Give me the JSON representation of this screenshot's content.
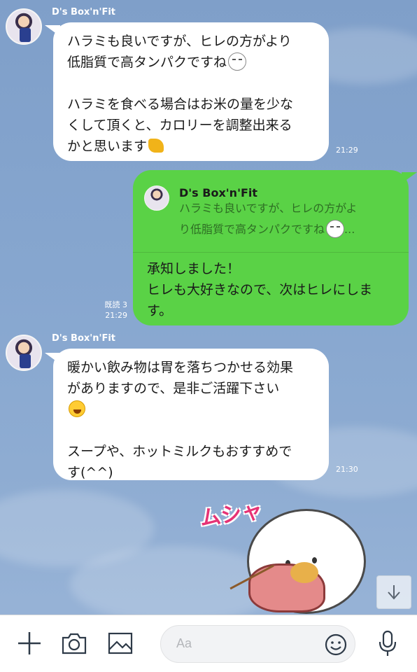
{
  "messages": [
    {
      "sender": "D's Box'n'Fit",
      "lines_a": [
        "ハラミも良いですが、ヒレの方がより",
        "低脂質で高タンパクですね"
      ],
      "lines_b": [
        "ハラミを食べる場合はお米の量を少な",
        "くして頂くと、カロリーを調整出来る",
        "かと思います"
      ],
      "time": "21:29"
    },
    {
      "reply_to": {
        "name": "D's Box'n'Fit",
        "lines": [
          "ハラミも良いですが、ヒレの方がよ",
          "り低脂質で高タンパクですね",
          "..."
        ]
      },
      "lines": [
        "承知しました！",
        "ヒレも大好きなので、次はヒレにしま",
        "す。"
      ],
      "read": "既読 3",
      "time": "21:29"
    },
    {
      "sender": "D's Box'n'Fit",
      "lines_a": [
        "暖かい飲み物は胃を落ちつかせる効果",
        "がありますので、是非ご活躍下さい"
      ],
      "lines_b": [
        "スープや、ホットミルクもおすすめで",
        "す(^^)"
      ],
      "time": "21:30"
    }
  ],
  "sticker": {
    "text": "ムシャ",
    "icon": "eating-character-sticker"
  },
  "input": {
    "placeholder": "Aa"
  },
  "icons": [
    "plus-icon",
    "camera-icon",
    "image-icon",
    "emoji-icon",
    "microphone-icon",
    "arrow-down-icon"
  ],
  "colors": {
    "my_bubble": "#5ad246",
    "their_bubble": "#ffffff",
    "background": "#86a6cf"
  }
}
